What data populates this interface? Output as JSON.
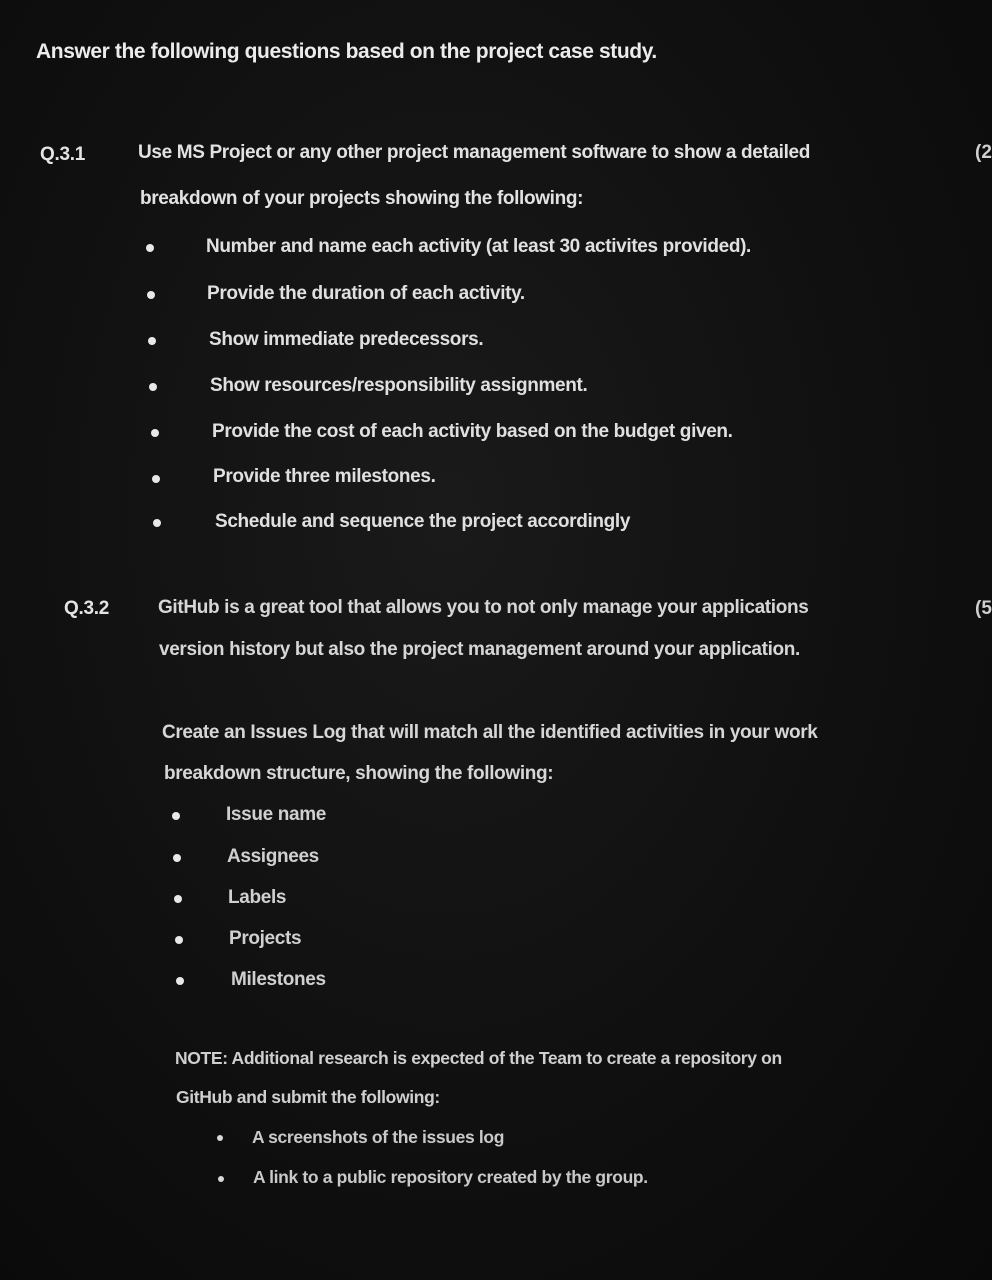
{
  "intro": "Answer the following questions based on the project case study.",
  "q31": {
    "number": "Q.3.1",
    "marks": "(2",
    "text_lines": [
      "Use MS Project or any other project management software to show a detailed",
      "breakdown of your projects showing the following:"
    ],
    "bullets": [
      "Number and name each activity (at least 30 activites provided).",
      "Provide the duration of each activity.",
      "Show immediate predecessors.",
      "Show resources/responsibility assignment.",
      "Provide the cost of each activity based on the budget given.",
      "Provide three milestones.",
      "Schedule and sequence the project accordingly"
    ]
  },
  "q32": {
    "number": "Q.3.2",
    "marks": "(5",
    "text_lines": [
      "GitHub is a great tool that allows you to not only manage your applications",
      "version history but also the project management around your application."
    ],
    "issues_lines": [
      "Create an Issues Log that will match all the identified activities in your work",
      "breakdown structure, showing the following:"
    ],
    "bullets": [
      "Issue name",
      "Assignees",
      "Labels",
      "Projects",
      "Milestones"
    ],
    "note_lines": [
      "NOTE: Additional research is expected of the Team to create a repository on",
      "GitHub and submit the following:"
    ],
    "note_bullets": [
      "A screenshots of the issues log",
      "A link to a public repository created by the group."
    ]
  }
}
